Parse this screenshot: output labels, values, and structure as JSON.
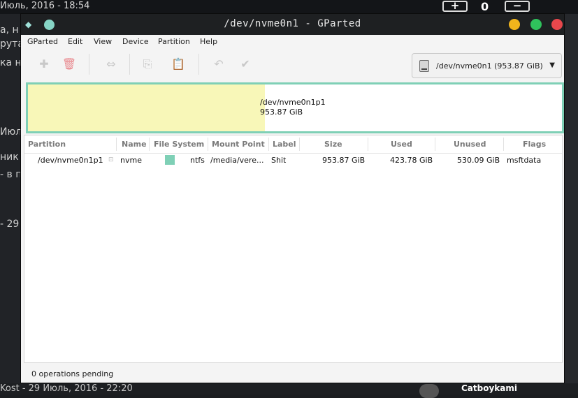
{
  "background": {
    "date": "Июль, 2016 - 18:54",
    "counter": "0",
    "plus_label": "+",
    "minus_label": "−",
    "left_fragments": [
      "а, н",
      "рута",
      "ка н",
      "Июл",
      "ник",
      "- в п",
      "- 29"
    ],
    "bottom_text": "Kost - 29 Июль, 2016 - 22:20",
    "bottom_user": "Catboykami"
  },
  "window": {
    "title": "/dev/nvme0n1 - GParted",
    "menu": [
      "GParted",
      "Edit",
      "View",
      "Device",
      "Partition",
      "Help"
    ],
    "device_selector": "/dev/nvme0n1 (953.87 GiB)",
    "map": {
      "partition_name": "/dev/nvme0n1p1",
      "partition_size": "953.87 GiB",
      "used_fraction": 0.444,
      "used_color": "#f8f7b8",
      "border_color": "#7fd0b6"
    },
    "columns": [
      "Partition",
      "Name",
      "File System",
      "Mount Point",
      "Label",
      "Size",
      "Used",
      "Unused",
      "Flags"
    ],
    "rows": [
      {
        "partition": "/dev/nvme0n1p1",
        "name": "nvme",
        "filesystem": "ntfs",
        "fs_color": "#7fd0b6",
        "mount_point": "/media/vere...",
        "label": "Shit",
        "size": "953.87 GiB",
        "used": "423.78 GiB",
        "unused": "530.09 GiB",
        "flags": "msftdata"
      }
    ],
    "status": "0 operations pending"
  }
}
